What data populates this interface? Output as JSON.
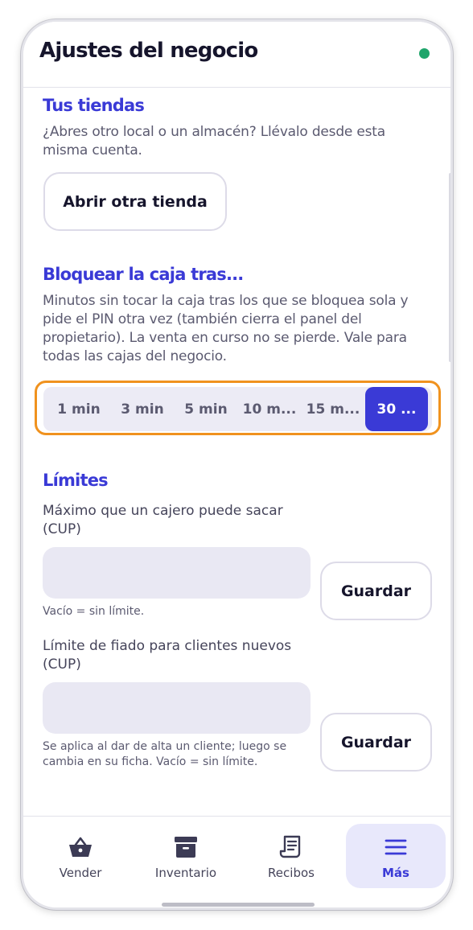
{
  "header": {
    "title": "Ajustes del negocio",
    "status_color": "#1fa56b"
  },
  "stores": {
    "title": "Tus tiendas",
    "description": "¿Abres otro local o un almacén? Llévalo desde esta misma cuenta.",
    "button_label": "Abrir otra tienda"
  },
  "lock": {
    "title": "Bloquear la caja tras...",
    "description": "Minutos sin tocar la caja tras los que se bloquea sola y pide el PIN otra vez (también cierra el panel del propietario). La venta en curso no se pierde. Vale para todas las cajas del negocio.",
    "options": [
      "1 min",
      "3 min",
      "5 min",
      "10 m...",
      "15 m...",
      "30 ..."
    ],
    "selected_index": 5
  },
  "limits": {
    "title": "Límites",
    "cashier_max_label": "Máximo que un cajero puede sacar (CUP)",
    "cashier_max_value": "",
    "cashier_max_hint": "Vacío = sin límite.",
    "credit_limit_label": "Límite de fiado para clientes nuevos (CUP)",
    "credit_limit_value": "",
    "credit_limit_hint": "Se aplica al dar de alta un cliente; luego se cambia en su ficha. Vacío = sin límite.",
    "save_label": "Guardar"
  },
  "nav": {
    "items": [
      {
        "label": "Vender",
        "icon": "basket-icon"
      },
      {
        "label": "Inventario",
        "icon": "archive-box-icon"
      },
      {
        "label": "Recibos",
        "icon": "receipt-icon"
      },
      {
        "label": "Más",
        "icon": "menu-icon"
      }
    ],
    "active_index": 3
  },
  "colors": {
    "accent": "#3a3ad6",
    "highlight": "#f0921e",
    "status": "#1fa56b"
  }
}
